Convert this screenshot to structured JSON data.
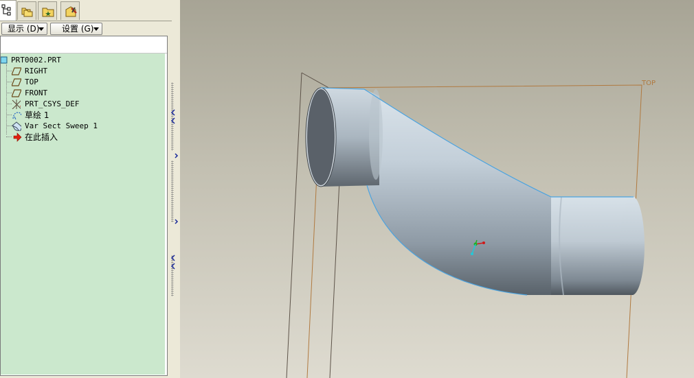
{
  "tabs": [
    {
      "icon": "model-tree-icon",
      "active": true
    },
    {
      "icon": "folder-browser-icon",
      "active": false
    },
    {
      "icon": "favorites-folder-icon",
      "active": false
    },
    {
      "icon": "tools-icon",
      "active": false
    }
  ],
  "toolbar": {
    "display_label": "显示 (D)",
    "settings_label": "设置 (G)"
  },
  "tree": {
    "root": {
      "label": "PRT0002.PRT",
      "icon": "part-icon"
    },
    "items": [
      {
        "label": "RIGHT",
        "icon": "datum-plane-icon"
      },
      {
        "label": "TOP",
        "icon": "datum-plane-icon"
      },
      {
        "label": "FRONT",
        "icon": "datum-plane-icon"
      },
      {
        "label": "PRT_CSYS_DEF",
        "icon": "coordinate-system-icon"
      },
      {
        "label": "草绘 1",
        "icon": "sketch-icon"
      },
      {
        "label": "Var Sect Sweep 1",
        "icon": "variable-section-sweep-icon"
      },
      {
        "label": "在此插入",
        "icon": "insert-here-arrow-icon"
      }
    ]
  },
  "viewport": {
    "datum_label_top": "TOP",
    "colors": {
      "datum_plane_top": "#b0793f",
      "datum_plane_other": "#5c5248",
      "solid_body": "#b9c6d0",
      "solid_edge": "#4aa3e0"
    }
  }
}
